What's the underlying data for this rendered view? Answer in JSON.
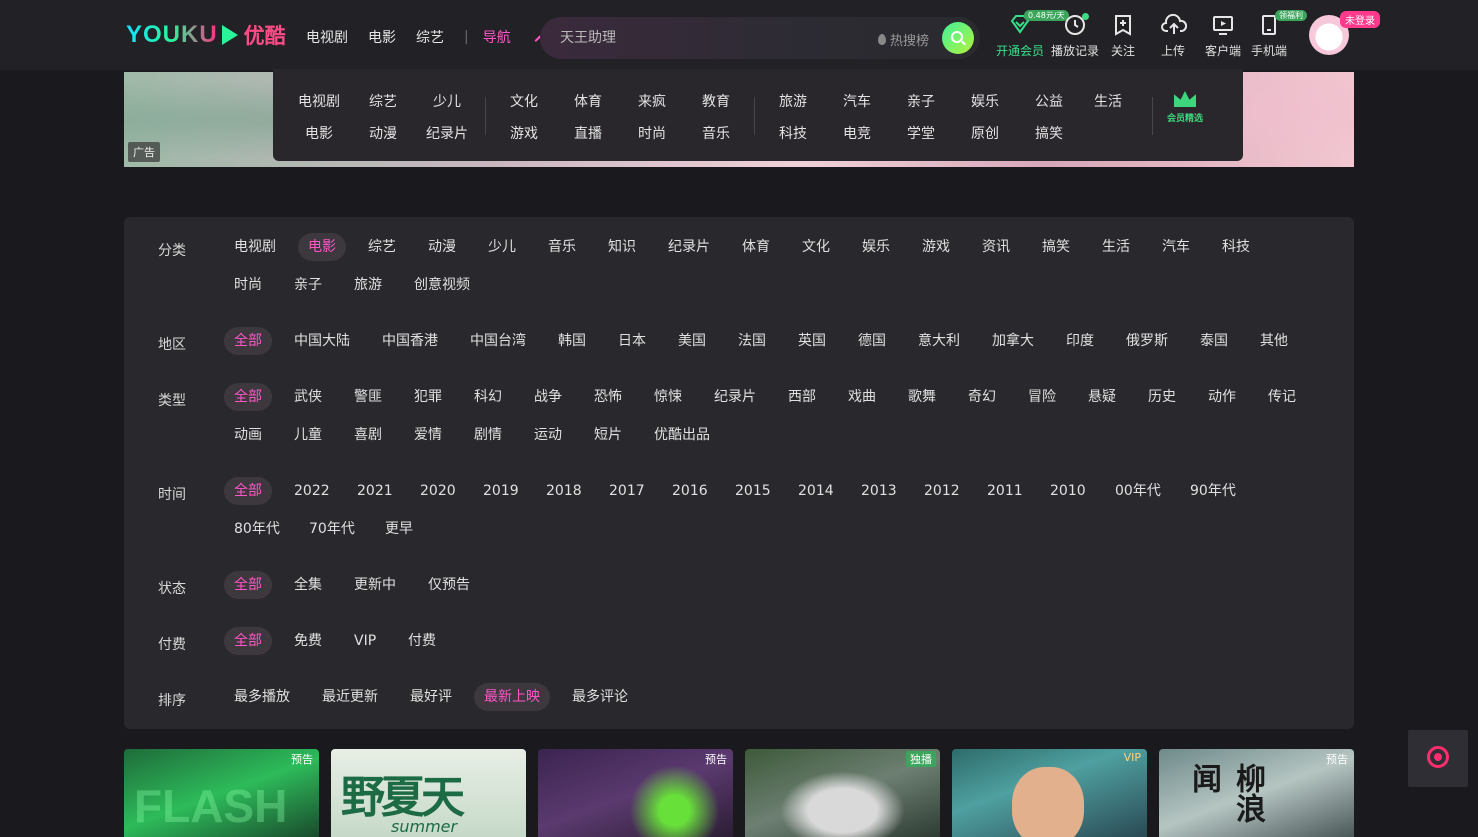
{
  "header": {
    "logo_text": "YOUKU",
    "logo_cn": "优酷",
    "nav": [
      "电视剧",
      "电影",
      "综艺"
    ],
    "nav_active": "导航",
    "search_placeholder": "天王助理",
    "hot_label": "热搜榜",
    "tools": [
      {
        "label": "开通会员",
        "icon": "vip-diamond-icon",
        "badge": "0.48元/天"
      },
      {
        "label": "播放记录",
        "icon": "history-clock-icon"
      },
      {
        "label": "关注",
        "icon": "follow-plus-icon"
      },
      {
        "label": "上传",
        "icon": "upload-cloud-icon"
      },
      {
        "label": "客户端",
        "icon": "desktop-client-icon"
      },
      {
        "label": "手机端",
        "icon": "phone-icon",
        "badge": "领福利"
      }
    ],
    "login_badge": "未登录"
  },
  "banner": {
    "ad_label": "广告"
  },
  "dropnav": {
    "group1_row1": [
      "电视剧",
      "综艺",
      "少儿"
    ],
    "group1_row2": [
      "电影",
      "动漫",
      "纪录片"
    ],
    "group2_row1": [
      "文化",
      "体育",
      "来疯",
      "教育"
    ],
    "group2_row2": [
      "游戏",
      "直播",
      "时尚",
      "音乐"
    ],
    "group3_row1": [
      "旅游",
      "汽车",
      "亲子",
      "娱乐",
      "公益",
      "生活"
    ],
    "group3_row2": [
      "科技",
      "电竞",
      "学堂",
      "原创",
      "搞笑"
    ],
    "vip_pick": "会员精选"
  },
  "filters": {
    "category": {
      "label": "分类",
      "row1": [
        "电视剧",
        "电影",
        "综艺",
        "动漫",
        "少儿",
        "音乐",
        "知识",
        "纪录片",
        "体育",
        "文化",
        "娱乐",
        "游戏",
        "资讯",
        "搞笑",
        "生活",
        "汽车",
        "科技"
      ],
      "row2": [
        "时尚",
        "亲子",
        "旅游",
        "创意视频"
      ],
      "selected": "电影"
    },
    "region": {
      "label": "地区",
      "row1": [
        "全部",
        "中国大陆",
        "中国香港",
        "中国台湾",
        "韩国",
        "日本",
        "美国",
        "法国",
        "英国",
        "德国",
        "意大利",
        "加拿大",
        "印度",
        "俄罗斯",
        "泰国",
        "其他"
      ],
      "selected": "全部"
    },
    "genre": {
      "label": "类型",
      "row1": [
        "全部",
        "武侠",
        "警匪",
        "犯罪",
        "科幻",
        "战争",
        "恐怖",
        "惊悚",
        "纪录片",
        "西部",
        "戏曲",
        "歌舞",
        "奇幻",
        "冒险",
        "悬疑",
        "历史",
        "动作",
        "传记"
      ],
      "row2": [
        "动画",
        "儿童",
        "喜剧",
        "爱情",
        "剧情",
        "运动",
        "短片",
        "优酷出品"
      ],
      "selected": "全部"
    },
    "time": {
      "label": "时间",
      "row1": [
        "全部",
        "2022",
        "2021",
        "2020",
        "2019",
        "2018",
        "2017",
        "2016",
        "2015",
        "2014",
        "2013",
        "2012",
        "2011",
        "2010",
        "00年代",
        "90年代"
      ],
      "row2": [
        "80年代",
        "70年代",
        "更早"
      ],
      "selected": "全部"
    },
    "status": {
      "label": "状态",
      "row1": [
        "全部",
        "全集",
        "更新中",
        "仅预告"
      ],
      "selected": "全部"
    },
    "pay": {
      "label": "付费",
      "row1": [
        "全部",
        "免费",
        "VIP",
        "付费"
      ],
      "selected": "全部"
    },
    "sort": {
      "label": "排序",
      "row1": [
        "最多播放",
        "最近更新",
        "最好评",
        "最新上映",
        "最多评论"
      ],
      "selected": "最新上映"
    }
  },
  "cards": [
    {
      "tag": "预告",
      "poster_text": "FLASH"
    },
    {
      "tag": "",
      "poster_text": "野夏天",
      "poster_sub": "summer"
    },
    {
      "tag": "预告"
    },
    {
      "tag": "独播"
    },
    {
      "tag": "VIP"
    },
    {
      "tag": "预告",
      "poster_text": "柳浪闻"
    }
  ],
  "colors": {
    "accent": "#ff57c8",
    "vip_green": "#34e08a",
    "panel": "#29282d",
    "bg": "#1a1a1e"
  }
}
